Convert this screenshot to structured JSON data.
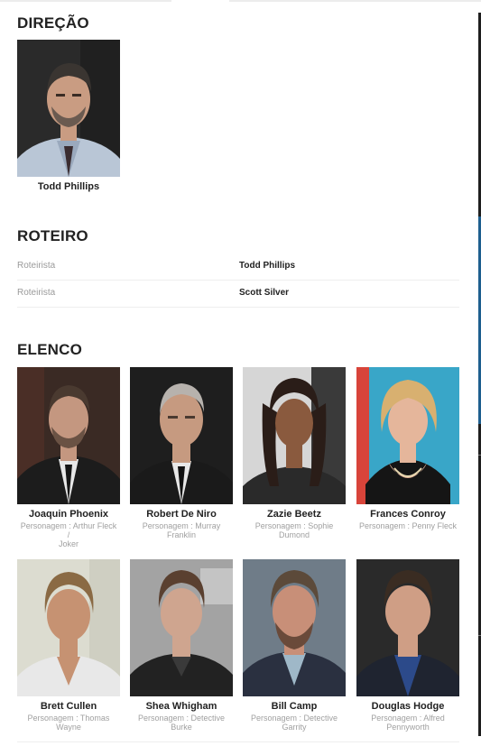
{
  "direction": {
    "title": "DIREÇÃO",
    "people": [
      {
        "name": "Todd Phillips"
      }
    ]
  },
  "screenplay": {
    "title": "ROTEIRO",
    "rows": [
      {
        "role": "Roteirista",
        "name": "Todd Phillips"
      },
      {
        "role": "Roteirista",
        "name": "Scott Silver"
      }
    ]
  },
  "cast": {
    "title": "ELENCO",
    "members": [
      {
        "name": "Joaquin Phoenix",
        "role_line1": "Personagem : Arthur Fleck /",
        "role_line2": "Joker"
      },
      {
        "name": "Robert De Niro",
        "role_line1": "Personagem : Murray",
        "role_line2": "Franklin"
      },
      {
        "name": "Zazie Beetz",
        "role_line1": "Personagem : Sophie",
        "role_line2": "Dumond"
      },
      {
        "name": "Frances Conroy",
        "role_line1": "Personagem : Penny Fleck",
        "role_line2": ""
      },
      {
        "name": "Brett Cullen",
        "role_line1": "Personagem : Thomas",
        "role_line2": "Wayne"
      },
      {
        "name": "Shea Whigham",
        "role_line1": "Personagem : Detective",
        "role_line2": "Burke"
      },
      {
        "name": "Bill Camp",
        "role_line1": "Personagem : Detective",
        "role_line2": "Garrity"
      },
      {
        "name": "Douglas Hodge",
        "role_line1": "Personagem : Alfred",
        "role_line2": "Pennyworth"
      }
    ]
  },
  "photo_palette": {
    "todd": {
      "bg": "#2a2a2a",
      "skin": "#c99c82",
      "hair": "#3a3531",
      "shirt": "#b9c6d6"
    },
    "joaquin": {
      "bg": "#3a2a24",
      "skin": "#c49780",
      "hair": "#4a3a30",
      "shirt": "#1c1c1c"
    },
    "deniro": {
      "bg": "#1e1e1e",
      "skin": "#c69a80",
      "hair": "#b7b2ad",
      "shirt": "#1a1a1a"
    },
    "zazie": {
      "bg": "#d6d6d6",
      "skin": "#8a5a3e",
      "hair": "#2a1d18",
      "shirt": "#2a2a2a"
    },
    "frances": {
      "bg": "#39a6c8",
      "skin": "#e5b69b",
      "hair": "#d8b070",
      "shirt": "#151515"
    },
    "brett": {
      "bg": "#dcdcd0",
      "skin": "#c69272",
      "hair": "#8a6a44",
      "shirt": "#e8e8e8"
    },
    "shea": {
      "bg": "#a3a3a3",
      "skin": "#cfa58f",
      "hair": "#5a4030",
      "shirt": "#222222"
    },
    "bill": {
      "bg": "#6f7c88",
      "skin": "#c88f78",
      "hair": "#5c4a3a",
      "shirt": "#2a3040"
    },
    "douglas": {
      "bg": "#2a2a2a",
      "skin": "#cf9e85",
      "hair": "#3a2c22",
      "shirt": "#2c4a8a"
    }
  }
}
